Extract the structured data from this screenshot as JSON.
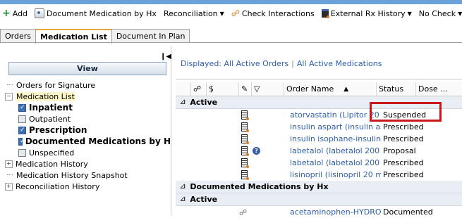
{
  "toolbar": {
    "add": "Add",
    "document_medication": "Document Medication by Hx",
    "reconciliation": "Reconciliation",
    "check_interactions": "Check Interactions",
    "external_rx_history": "External Rx History",
    "no_check": "No Check"
  },
  "tabs": [
    "Orders",
    "Medication List",
    "Document In Plan"
  ],
  "left": {
    "view_title": "View",
    "tree": [
      {
        "label": "Orders for Signature"
      },
      {
        "label": "Medication List"
      },
      {
        "label": "Inpatient"
      },
      {
        "label": "Outpatient"
      },
      {
        "label": "Prescription"
      },
      {
        "label": "Documented Medications by H"
      },
      {
        "label": "Unspecified"
      },
      {
        "label": "Medication History"
      },
      {
        "label": "Medication History Snapshot"
      },
      {
        "label": "Reconciliation History"
      }
    ]
  },
  "filter": {
    "displayed": "Displayed: All Active Orders",
    "meds": "All Active Medications"
  },
  "grid": {
    "headers": {
      "dollar": "$",
      "order_name": "Order Name",
      "sort_indicator": "▲",
      "status": "Status",
      "dose": "Dose ..."
    },
    "group_active": "Active",
    "rows": [
      {
        "name": "atorvastatin (Lipitor 20 ...",
        "status": "Suspended"
      },
      {
        "name": "insulin aspart (insulin as...",
        "status": "Prescribed"
      },
      {
        "name": "insulin isophane-insulin ...",
        "status": "Prescribed"
      },
      {
        "name": "labetalol (labetalol 200 ...",
        "status": "Proposal"
      },
      {
        "name": "labetalol (labetalol 200 ...",
        "status": "Prescribed"
      },
      {
        "name": "lisinopril (lisinopril 20 mg...",
        "status": "Prescribed"
      }
    ],
    "group_documented": "Documented Medications by Hx",
    "group_active2": "Active",
    "doc_rows": [
      {
        "name": "acetaminophen-HYDRO...",
        "status": "Documented"
      }
    ]
  },
  "colors": {
    "link": "#2e5fa8",
    "highlight_box": "#c4181c",
    "tab_accent": "#e3a83b"
  }
}
